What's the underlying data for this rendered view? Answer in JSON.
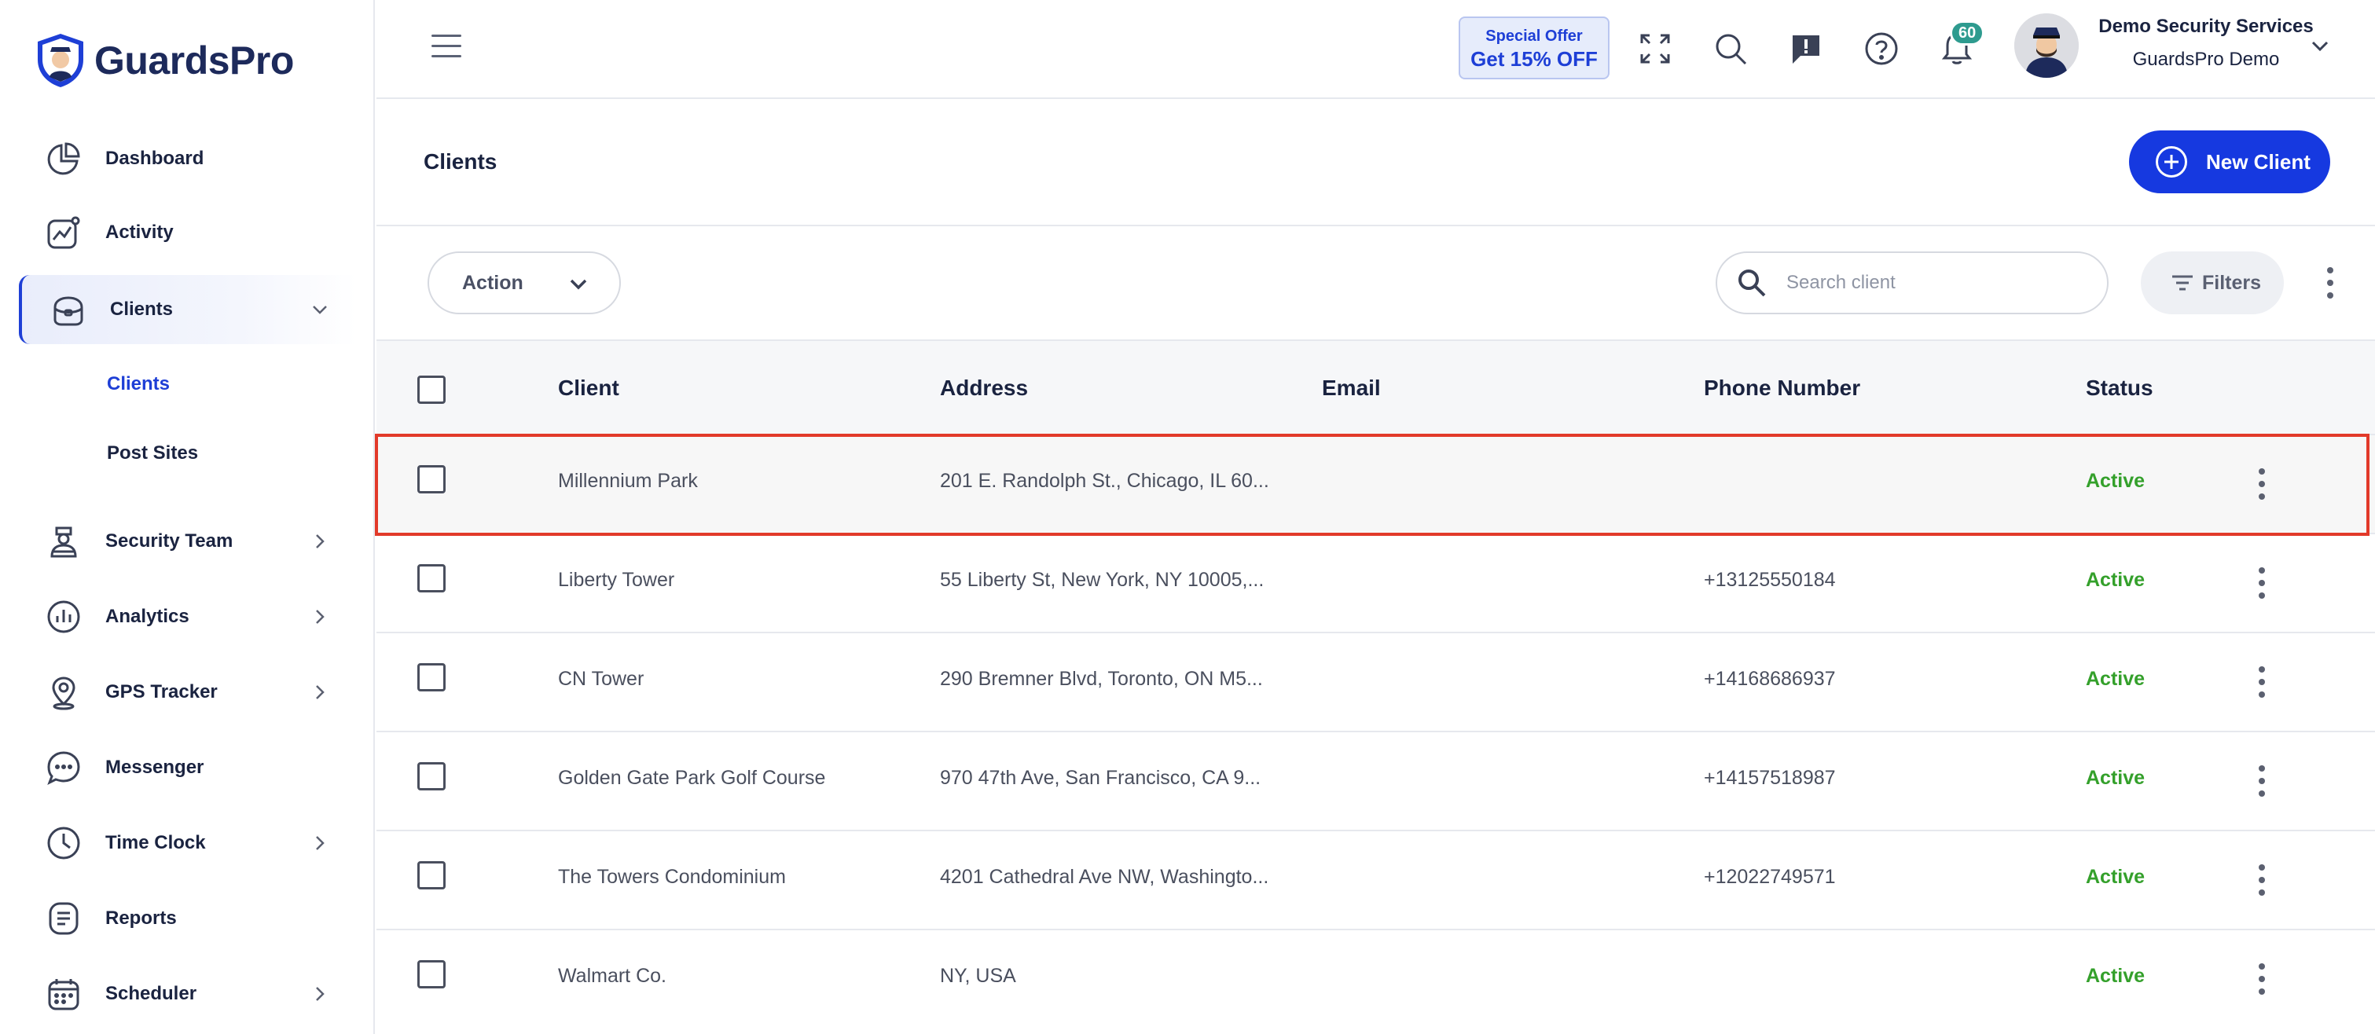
{
  "app": {
    "name": "GuardsPro"
  },
  "sidebar": {
    "items": [
      {
        "label": "Dashboard",
        "icon": "pie-chart-icon"
      },
      {
        "label": "Activity",
        "icon": "activity-chart-icon"
      },
      {
        "label": "Clients",
        "icon": "briefcase-icon",
        "expanded": true
      },
      {
        "label": "Security Team",
        "icon": "guard-icon"
      },
      {
        "label": "Analytics",
        "icon": "analytics-icon"
      },
      {
        "label": "GPS Tracker",
        "icon": "location-pin-icon"
      },
      {
        "label": "Messenger",
        "icon": "chat-bubble-icon"
      },
      {
        "label": "Time Clock",
        "icon": "clock-icon"
      },
      {
        "label": "Reports",
        "icon": "report-icon"
      },
      {
        "label": "Scheduler",
        "icon": "calendar-icon"
      }
    ],
    "clients_sub": [
      {
        "label": "Clients",
        "current": true
      },
      {
        "label": "Post Sites",
        "current": false
      }
    ]
  },
  "header": {
    "offer_line1": "Special Offer",
    "offer_line2": "Get 15% OFF",
    "notification_count": "60",
    "company_name": "Demo Security Services",
    "account_name": "GuardsPro Demo"
  },
  "page": {
    "title": "Clients",
    "new_button": "New Client"
  },
  "toolbar": {
    "action_label": "Action",
    "search_placeholder": "Search client",
    "filters_label": "Filters"
  },
  "table": {
    "columns": [
      "Client",
      "Address",
      "Email",
      "Phone Number",
      "Status"
    ],
    "rows": [
      {
        "client": "Millennium Park",
        "address": "201 E. Randolph St., Chicago, IL 60...",
        "email": "",
        "phone": "",
        "status": "Active"
      },
      {
        "client": "Liberty Tower",
        "address": "55 Liberty St, New York, NY 10005,...",
        "email": "",
        "phone": "+13125550184",
        "status": "Active"
      },
      {
        "client": "CN Tower",
        "address": "290 Bremner Blvd, Toronto, ON M5...",
        "email": "",
        "phone": "+14168686937",
        "status": "Active"
      },
      {
        "client": "Golden Gate Park Golf Course",
        "address": "970 47th Ave, San Francisco, CA 9...",
        "email": "",
        "phone": "+14157518987",
        "status": "Active"
      },
      {
        "client": "The Towers Condominium",
        "address": "4201 Cathedral Ave NW, Washingto...",
        "email": "",
        "phone": "+12022749571",
        "status": "Active"
      },
      {
        "client": "Walmart Co.",
        "address": "NY, USA",
        "email": "",
        "phone": "",
        "status": "Active"
      }
    ]
  },
  "colors": {
    "brand": "#1639e0",
    "status_active": "#34a02b",
    "highlight_outline": "#e23a2a",
    "badge": "#2e9b8f"
  }
}
